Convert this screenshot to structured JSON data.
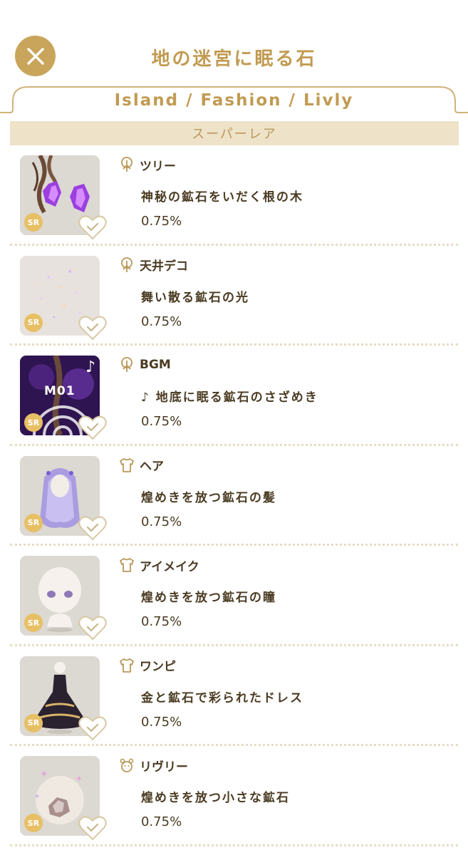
{
  "header": {
    "title": "地の迷宮に眠る石",
    "close_icon": "close-icon",
    "tab_path": "Island / Fashion / Livly"
  },
  "rarity": {
    "label": "スーパーレア"
  },
  "colors": {
    "gold": "#c9a55c",
    "title": "#c19b52",
    "band": "#eee3c9",
    "badge": "#e7c066",
    "text": "#4a3b22"
  },
  "items": [
    {
      "category": "ツリー",
      "category_icon": "tree-icon",
      "name": "神秘の鉱石をいだく根の木",
      "rate": "0.75%",
      "badge": "SR"
    },
    {
      "category": "天井デコ",
      "category_icon": "tree-icon",
      "name": "舞い散る鉱石の光",
      "rate": "0.75%",
      "badge": "SR"
    },
    {
      "category": "BGM",
      "category_icon": "tree-icon",
      "name": "♪ 地底に眠る鉱石のさざめき",
      "rate": "0.75%",
      "badge": "SR",
      "thumb_text": "M01"
    },
    {
      "category": "ヘア",
      "category_icon": "shirt-icon",
      "name": "煌めきを放つ鉱石の髪",
      "rate": "0.75%",
      "badge": "SR"
    },
    {
      "category": "アイメイク",
      "category_icon": "shirt-icon",
      "name": "煌めきを放つ鉱石の瞳",
      "rate": "0.75%",
      "badge": "SR"
    },
    {
      "category": "ワンピ",
      "category_icon": "shirt-icon",
      "name": "金と鉱石で彩られたドレス",
      "rate": "0.75%",
      "badge": "SR"
    },
    {
      "category": "リヴリー",
      "category_icon": "livly-icon",
      "name": "煌めきを放つ小さな鉱石",
      "rate": "0.75%",
      "badge": "SR"
    }
  ]
}
